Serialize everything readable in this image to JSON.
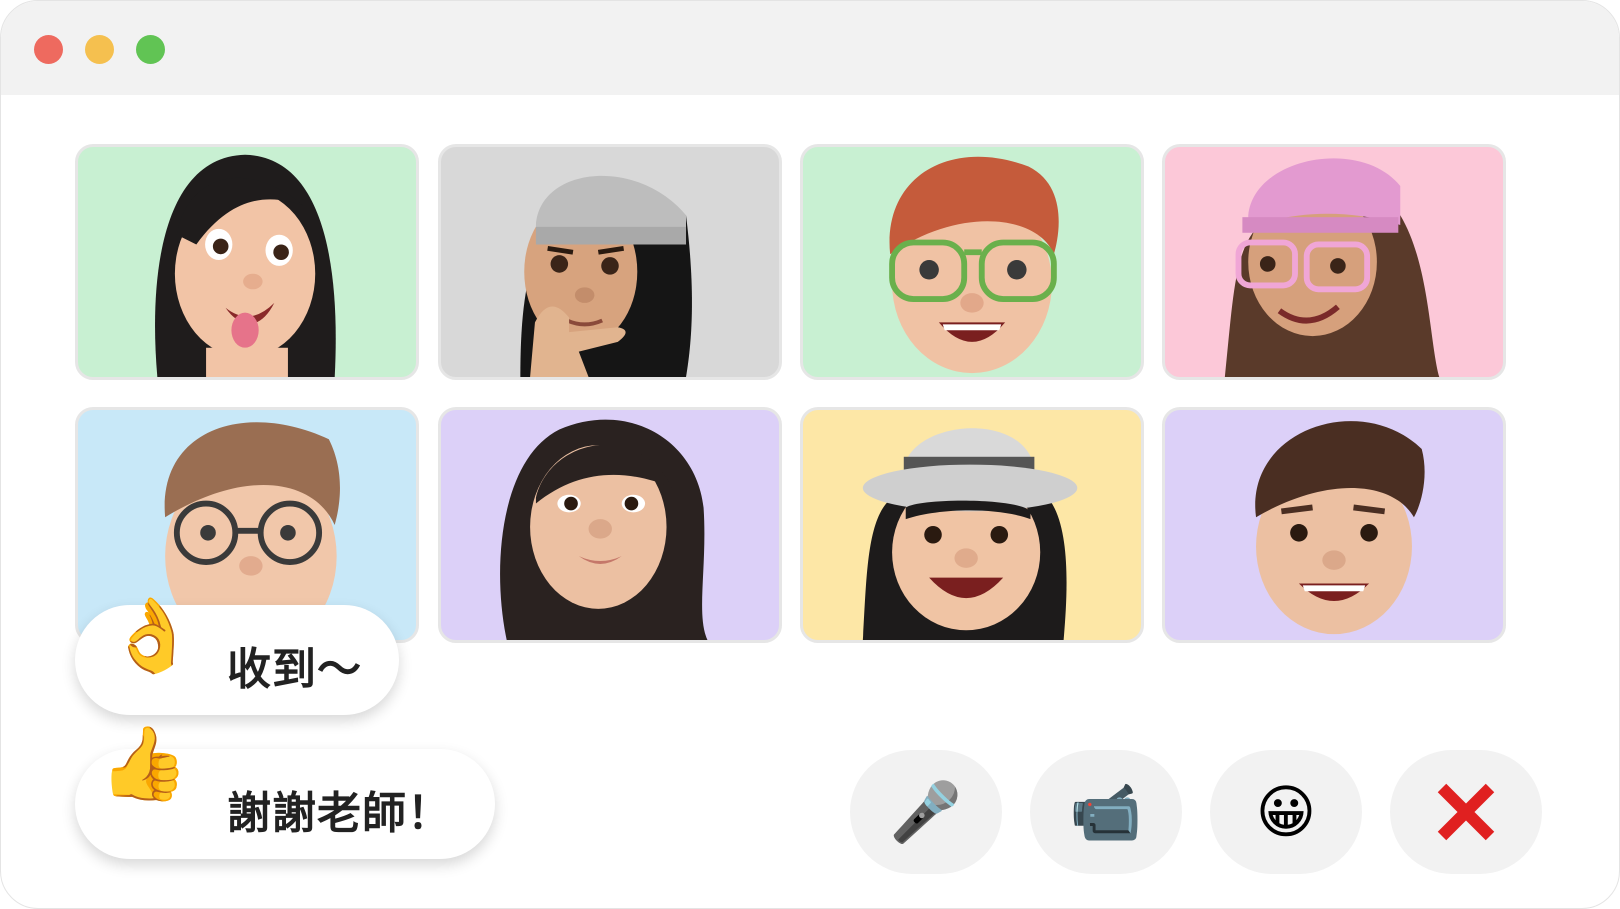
{
  "window": {
    "controls": [
      "close",
      "minimize",
      "zoom"
    ]
  },
  "participants": [
    {
      "icon": "memoji-girl-tongue-out-icon",
      "bg": "#c8f0d2"
    },
    {
      "icon": "memoji-thinking-beanie-icon",
      "bg": "#d8d8d8"
    },
    {
      "icon": "memoji-redhead-green-glasses-icon",
      "bg": "#c8f0d2"
    },
    {
      "icon": "memoji-pink-beanie-glasses-icon",
      "bg": "#fcc8d8"
    },
    {
      "icon": "memoji-boy-round-glasses-icon",
      "bg": "#c8e8f8"
    },
    {
      "icon": "memoji-woman-long-hair-icon",
      "bg": "#dcd0f8"
    },
    {
      "icon": "memoji-girl-hat-icon",
      "bg": "#fde7a6"
    },
    {
      "icon": "memoji-boy-smiling-icon",
      "bg": "#dcd0f8"
    }
  ],
  "chat": [
    {
      "emoji": "👌",
      "text": "收到～"
    },
    {
      "emoji": "👍",
      "text": "謝謝老師！"
    }
  ],
  "controls": {
    "mic": {
      "emoji": "🎤",
      "icon": "microphone-icon"
    },
    "camera": {
      "emoji": "📹",
      "icon": "video-camera-icon"
    },
    "reactions": {
      "emoji": "😀",
      "icon": "grinning-face-icon"
    },
    "leave": {
      "emoji": "❌",
      "icon": "close-icon"
    }
  },
  "colors": {
    "leave_red": "#e02020"
  }
}
